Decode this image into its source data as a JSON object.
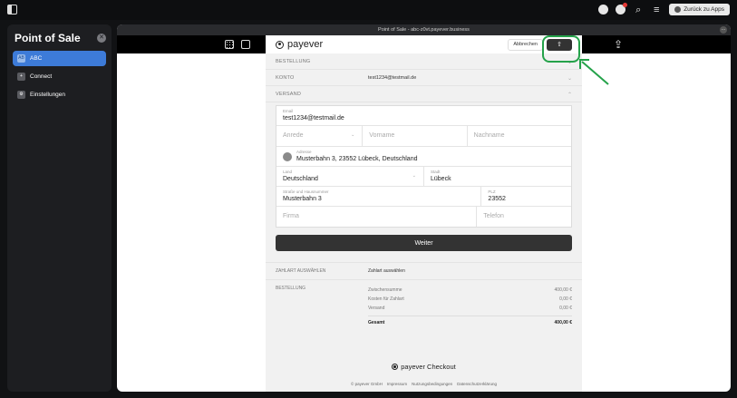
{
  "topbar": {
    "icons": [
      "sidebar-toggle-icon",
      "user-icon",
      "notification-icon",
      "search-icon",
      "menu-icon"
    ],
    "back_label": "Zurück zu Apps"
  },
  "sidebar": {
    "title": "Point of Sale",
    "items": [
      {
        "label": "ABC",
        "icon_text": "AB",
        "active": true
      },
      {
        "label": "Connect",
        "icon_text": "+",
        "active": false
      },
      {
        "label": "Einstellungen",
        "icon_text": "⚙",
        "active": false
      }
    ]
  },
  "window": {
    "title": "Point of Sale - abc-z0vt.payever.business"
  },
  "checkout": {
    "brand": "payever",
    "cancel_label": "Abbrechen",
    "sections": {
      "order_label": "BESTELLUNG",
      "account_label": "KONTO",
      "account_value": "test1234@testmail.de",
      "shipping_label": "VERSAND"
    },
    "form": {
      "email_label": "Email",
      "email_value": "test1234@testmail.de",
      "salutation_placeholder": "Anrede",
      "firstname_placeholder": "Vorname",
      "lastname_placeholder": "Nachname",
      "address_label": "Adresse",
      "address_value": "Musterbahn 3, 23552 Lübeck, Deutschland",
      "country_label": "Land",
      "country_value": "Deutschland",
      "city_label": "Stadt",
      "city_value": "Lübeck",
      "street_label": "Straße und Hausnummer",
      "street_value": "Musterbahn 3",
      "zip_label": "PLZ",
      "zip_value": "23552",
      "company_placeholder": "Firma",
      "phone_placeholder": "Telefon"
    },
    "next_label": "Weiter",
    "payment": {
      "label": "ZAHLART AUSWÄHLEN",
      "value": "Zahlart auswählen"
    },
    "summary": {
      "label": "BESTELLUNG",
      "subtotal_label": "Zwischensumme",
      "subtotal_value": "400,00 €",
      "payment_cost_label": "Kosten für Zahlart",
      "payment_cost_value": "0,00 €",
      "shipping_label": "Versand",
      "shipping_value": "0,00 €",
      "total_label": "Gesamt",
      "total_value": "400,00 €"
    },
    "footer": {
      "brand": "payever Checkout",
      "links": [
        "© payever GmbH",
        "Impressum",
        "Nutzungsbedingungen",
        "Datenschutzerklärung"
      ]
    }
  },
  "annotation": {
    "color": "#25a24a"
  }
}
